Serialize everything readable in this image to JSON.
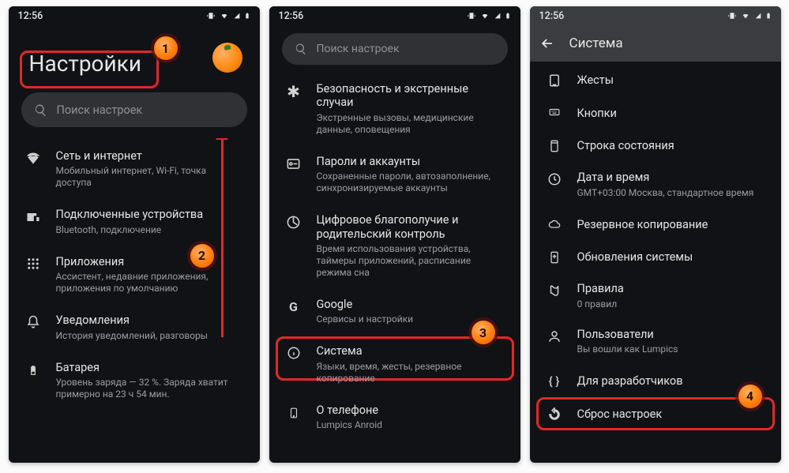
{
  "status": {
    "time": "12:56"
  },
  "panel1": {
    "title": "Настройки",
    "search_placeholder": "Поиск настроек",
    "items": [
      {
        "title": "Сеть и интернет",
        "sub": "Мобильный интернет, Wi-Fi, точка доступа"
      },
      {
        "title": "Подключенные устройства",
        "sub": "Bluetooth, подключение"
      },
      {
        "title": "Приложения",
        "sub": "Ассистент, недавние приложения, приложения по умолчанию"
      },
      {
        "title": "Уведомления",
        "sub": "История уведомлений, разговоры"
      },
      {
        "title": "Батарея",
        "sub": "Уровень заряда — 32 %. Заряда хватит примерно на 23 ч 54 мин."
      }
    ]
  },
  "panel2": {
    "search_placeholder": "Поиск настроек",
    "items": [
      {
        "title": "Безопасность и экстренные случаи",
        "sub": "Экстренные вызовы, медицинские данные, оповещения"
      },
      {
        "title": "Пароли и аккаунты",
        "sub": "Сохраненные пароли, автозаполнение, синхронизируемые аккаунты"
      },
      {
        "title": "Цифровое благополучие и родительский контроль",
        "sub": "Время использования устройства, таймеры приложений, расписание режима сна"
      },
      {
        "title": "Google",
        "sub": "Сервисы и настройки"
      },
      {
        "title": "Система",
        "sub": "Языки, время, жесты, резервное копирование"
      },
      {
        "title": "О телефоне",
        "sub": "Lumpics Anroid"
      }
    ]
  },
  "panel3": {
    "header": "Система",
    "items": [
      {
        "title": "Жесты",
        "sub": ""
      },
      {
        "title": "Кнопки",
        "sub": ""
      },
      {
        "title": "Строка состояния",
        "sub": ""
      },
      {
        "title": "Дата и время",
        "sub": "GMT+03:00 Москва, стандартное время"
      },
      {
        "title": "Резервное копирование",
        "sub": ""
      },
      {
        "title": "Обновления системы",
        "sub": ""
      },
      {
        "title": "Правила",
        "sub": "0 правил"
      },
      {
        "title": "Пользователи",
        "sub": "Вы вошли как Lumpics"
      },
      {
        "title": "Для разработчиков",
        "sub": ""
      },
      {
        "title": "Сброс настроек",
        "sub": ""
      }
    ]
  },
  "markers": {
    "m1": "1",
    "m2": "2",
    "m3": "3",
    "m4": "4"
  }
}
